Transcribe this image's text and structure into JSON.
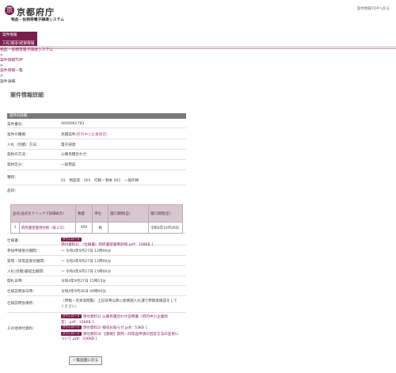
{
  "header": {
    "logo_mark": "京",
    "logo_name": "京都府庁",
    "system_name": "物品・役務等電子調達システム",
    "top_link": "案件情報TOPへ戻る"
  },
  "nav": {
    "btn_top": "案件情報",
    "btn_bottom": "入札(競争)結果情報"
  },
  "breadcrumbs": [
    "物品・役務等電子調達システム",
    ">",
    "案件情報TOP",
    ">",
    "案件情報一覧",
    ">",
    "案件詳細"
  ],
  "page_title": "案件情報詳細",
  "section_title": "案件の詳細",
  "detail": {
    "case_no_label": "案件番号：",
    "case_no": "4000061783",
    "kind_label": "案件の種類：",
    "kind_prefix": "見積案件",
    "kind_link": "(府内中小企業限定)",
    "method_label": "入札（見積）方法：",
    "method": "電子調達",
    "contract_label": "契約の方法：",
    "contract": "公募見積合わせ",
    "division_label": "契約区分：",
    "division": "一般用品",
    "category_label": "種目：",
    "category": "01　物品等　001　印刷・製本 001　一般印刷",
    "items_label": "品目："
  },
  "items_table": {
    "headers": [
      "品名(品名をクリックで詳細表示)",
      "数量",
      "単位",
      "履行期間(自)",
      "履行期間(至)"
    ],
    "rows": [
      {
        "no": "1",
        "name": "府府書望書用封筒（角２号）",
        "qty": "600",
        "unit": "枚",
        "from": "",
        "to": "令和4年10月26日"
      }
    ]
  },
  "dl_label": "ダウンロード",
  "info": {
    "spec_label": "仕様書：",
    "spec_file": "添付資料1[ （仕様書）府府書望書用封筒.pdf：108KB ]",
    "reg_label": "参加申請受付期間：",
    "reg": "～ 令和4年9月27日 12時00分",
    "qa_label": "質問・同等品受付期間：",
    "qa": "～ 令和4年9月27日 12時00分",
    "bid_label": "入札(見積)書提出期間：",
    "bid": "～ 令和4年9月27日 15時00分",
    "open_label": "開札日時：",
    "open": "令和4年9月27日 15時15分",
    "explain_label": "仕様説明会日時：",
    "explain": "令和4年9月26日 09時00分",
    "place_label": "仕様説明会場所：",
    "place": "（原稿・見本等閲覧）上記日時以降に総務部入札課で原稿等確認をしてください。",
    "other_label": "その他添付資料：",
    "other_files": [
      "添付資料1[ 公募見積合わせ説明書（府内中小企業限定）.pdf：156KB ]",
      "添付資料2[ 検収お知らせ.pdf：53KB ]",
      "添付資料3[ 【重要】質問・同等品申請の回答方法の変更について.pdf：336KB ]"
    ]
  },
  "back_button": "一覧画面に戻る"
}
